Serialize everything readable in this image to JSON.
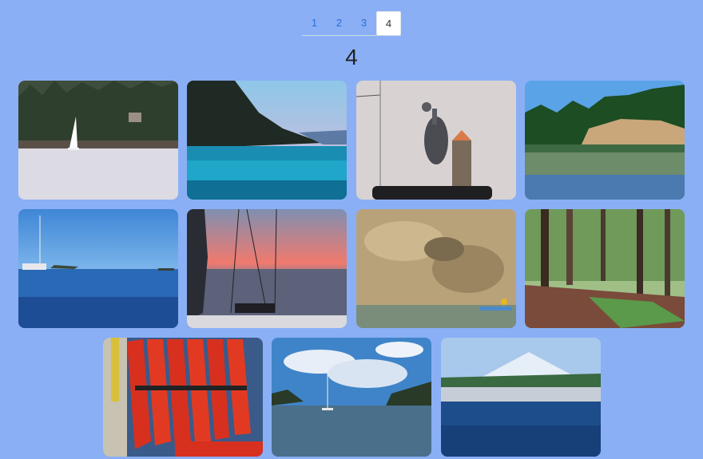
{
  "pagination": {
    "pages": [
      "1",
      "2",
      "3",
      "4"
    ],
    "current": "4"
  },
  "heading": "4",
  "photos": [
    {
      "name": "sailboat-forest-photo"
    },
    {
      "name": "island-sunset-water-photo"
    },
    {
      "name": "heron-on-boat-photo"
    },
    {
      "name": "cliff-reflection-photo"
    },
    {
      "name": "anchored-sailboat-photo"
    },
    {
      "name": "sunset-rigging-photo"
    },
    {
      "name": "sandstone-kayak-photo"
    },
    {
      "name": "forest-trail-photo"
    },
    {
      "name": "life-jackets-photo"
    },
    {
      "name": "cloudy-cove-photo"
    },
    {
      "name": "mountain-marina-photo"
    }
  ]
}
